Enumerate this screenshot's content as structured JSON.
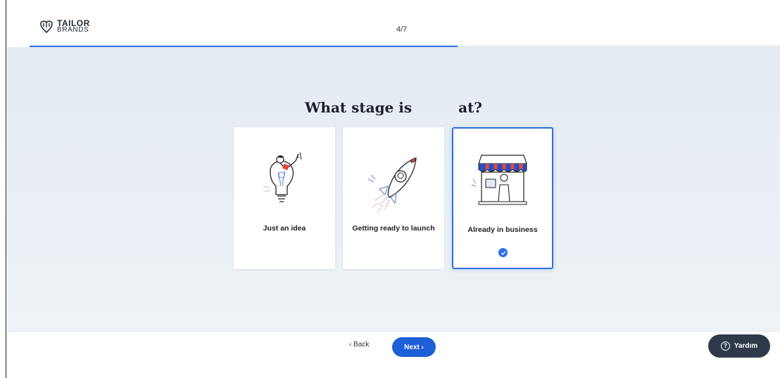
{
  "header": {
    "logo_line1": "TAILOR",
    "logo_line2": "BRANDS",
    "step": "4/7",
    "progress_fraction": 0.57
  },
  "main": {
    "title_part1": "What stage is",
    "title_part2": "at?",
    "cards": [
      {
        "label": "Just an idea",
        "selected": false,
        "icon": "lightbulb-illustration"
      },
      {
        "label": "Getting ready to launch",
        "selected": false,
        "icon": "rocket-illustration"
      },
      {
        "label": "Already in business",
        "selected": true,
        "icon": "storefront-illustration"
      }
    ]
  },
  "footer": {
    "back_label": "‹ Back",
    "next_label": "Next ›",
    "help_label": "Yardım"
  },
  "colors": {
    "accent": "#2f6fe4",
    "next_button": "#1d5fd6",
    "help_button": "#2e3a4a"
  }
}
